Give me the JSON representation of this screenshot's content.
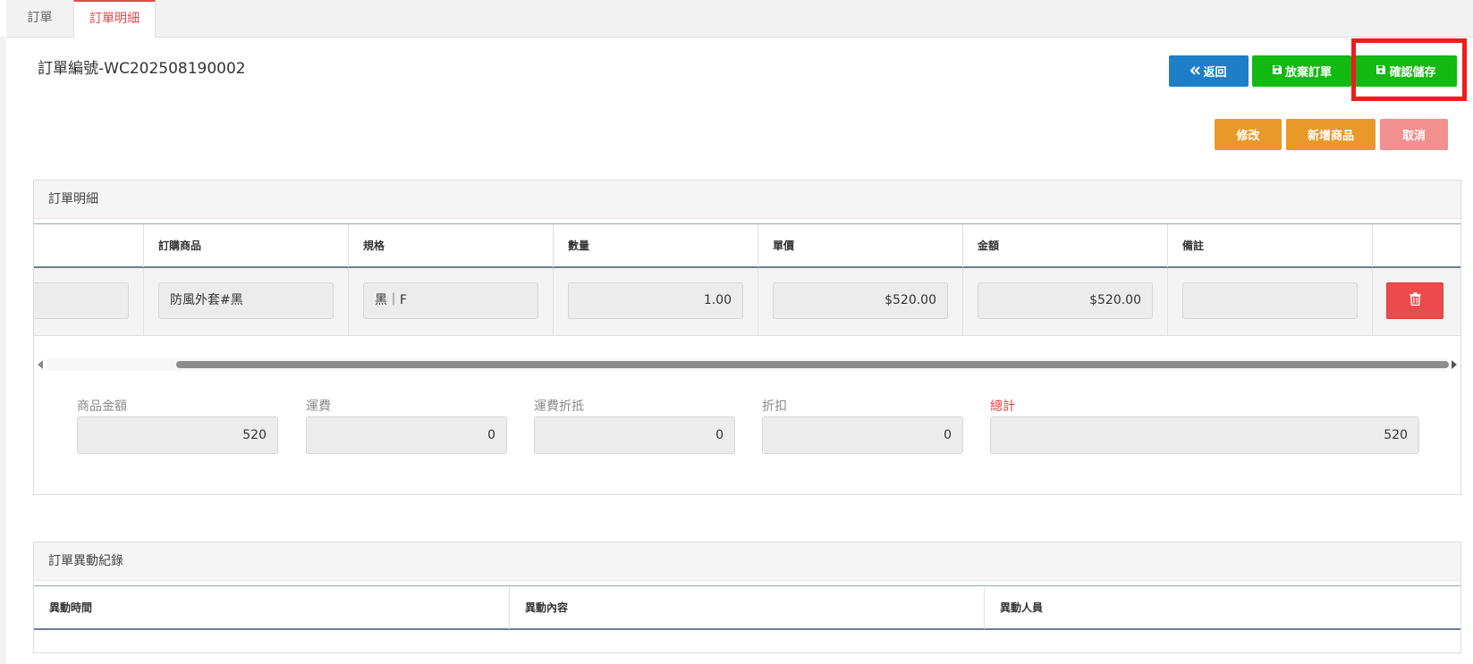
{
  "tabs": [
    {
      "label": "訂單"
    },
    {
      "label": "訂單明細"
    }
  ],
  "order": {
    "title": "訂單編號-WC202508190002"
  },
  "actions": {
    "back_label": "返回",
    "abandon_label": "放棄訂單",
    "confirm_label": "確認儲存",
    "edit_label": "修改",
    "add_label": "新增商品",
    "cancel_label": "取消"
  },
  "detail_panel": {
    "title": "訂單明細",
    "columns": [
      "",
      "訂購商品",
      "規格",
      "數量",
      "單價",
      "金額",
      "備註",
      ""
    ],
    "row": {
      "first": "",
      "product": "防風外套#黑",
      "spec": "黑｜F",
      "quantity": "1.00",
      "unit_price": "$520.00",
      "amount": "$520.00",
      "note": ""
    }
  },
  "totals": {
    "items": [
      {
        "label": "商品金額",
        "value": "520"
      },
      {
        "label": "運費",
        "value": "0"
      },
      {
        "label": "運費折抵",
        "value": "0"
      },
      {
        "label": "折扣",
        "value": "0"
      },
      {
        "label": "總計",
        "value": "520"
      }
    ]
  },
  "log_panel": {
    "title": "訂單異動紀錄",
    "columns": [
      "異動時間",
      "異動內容",
      "異動人員"
    ]
  },
  "colors": {
    "accent_red": "#e04a4a",
    "primary_blue": "#1e7ec8",
    "success_green": "#11b911",
    "warning_orange": "#e8992a",
    "danger_light": "#f28f8f",
    "danger": "#ec4b4b",
    "highlight_red": "#ee1c1c"
  },
  "icons": {
    "back": "double-chevron-left-icon",
    "save": "floppy-disk-icon",
    "delete": "trash-icon"
  }
}
